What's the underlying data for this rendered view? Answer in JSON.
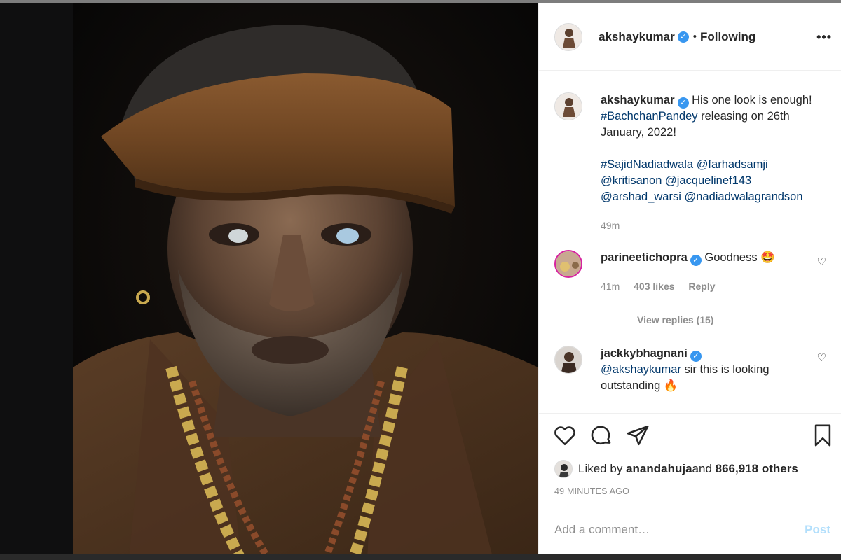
{
  "post": {
    "author": "akshaykumar",
    "follow_status": "Following",
    "separator": "•",
    "more_icon": "more-options-icon"
  },
  "caption": {
    "username": "akshaykumar",
    "text_1": "His one look is enough! ",
    "hashtag_1": "#BachchanPandey",
    "text_2": " releasing on 26th January, 2022!",
    "line_2": [
      {
        "text": "#SajidNadiadwala",
        "type": "tag"
      },
      {
        "text": "@farhadsamji",
        "type": "tag"
      },
      {
        "text": "@kritisanon",
        "type": "tag"
      },
      {
        "text": "@jacquelinef143",
        "type": "tag"
      },
      {
        "text": "@arshad_warsi",
        "type": "tag"
      },
      {
        "text": "@nadiadwalagrandson",
        "type": "tag"
      }
    ],
    "time": "49m"
  },
  "comments": [
    {
      "username": "parineetichopra",
      "text": "Goodness 🤩",
      "time": "41m",
      "likes": "403 likes",
      "reply": "Reply",
      "view_replies": "View replies (15)"
    },
    {
      "username": "jackkybhagnani",
      "mention": "@akshaykumar",
      "text": " sir this is looking outstanding 🔥"
    }
  ],
  "actions": {
    "icons": [
      "heart-icon",
      "comment-icon",
      "share-icon",
      "bookmark-icon"
    ],
    "liked_by_prefix": "Liked by ",
    "liked_by_user": "anandahuja",
    "liked_by_middle": " and ",
    "liked_by_count": "866,918 others",
    "time_ago": "49 MINUTES AGO"
  },
  "add_comment": {
    "placeholder": "Add a comment…",
    "post_label": "Post"
  },
  "colors": {
    "link": "#00376b",
    "verified": "#3897f0",
    "muted": "#8e8e8e",
    "post_disabled": "#b2dffc"
  }
}
